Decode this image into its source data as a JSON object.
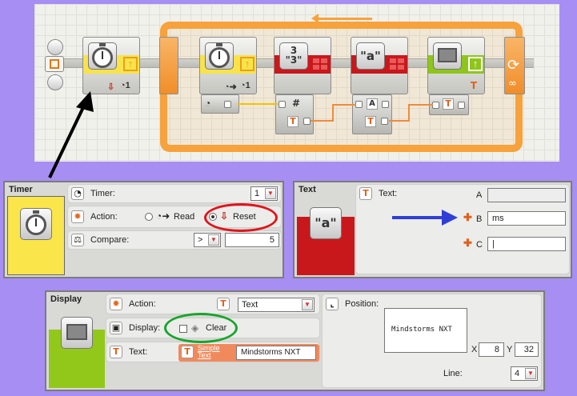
{
  "colors": {
    "background": "#a78ef3",
    "loop": "#f7a23c",
    "timer_accent": "#f8e34a",
    "text_accent": "#c8181c",
    "display_accent": "#8ec51b",
    "wire": "#f08a3b",
    "red_ring": "#e0141b",
    "blue_arrow": "#2f3fd6",
    "green_ring": "#17a52d"
  },
  "program": {
    "icons": [
      "timer-icon",
      "timer-icon",
      "number-to-text-icon",
      "text-icon",
      "display-icon",
      "loop-icon"
    ],
    "glyphs": {
      "num_top": "3",
      "num_bottom": "\"3\"",
      "text_a": "\"a\"",
      "hash": "#",
      "t": "T",
      "a": "A",
      "infinity": "∞"
    }
  },
  "timer_panel": {
    "title": "Timer",
    "timer_label": "Timer:",
    "timer_value": "1",
    "action_label": "Action:",
    "read_label": "Read",
    "reset_label": "Reset",
    "selected_action": "Reset",
    "compare_label": "Compare:",
    "compare_op": ">",
    "compare_value": "5"
  },
  "text_panel": {
    "title": "Text",
    "preview_text": "\"a\"",
    "text_label": "Text:",
    "a_label": "A",
    "a_value": "",
    "b_label": "B",
    "b_value": "ms",
    "c_label": "C",
    "c_value": "|",
    "t_glyph": "T"
  },
  "display_panel": {
    "title": "Display",
    "action_label": "Action:",
    "action_value": "Text",
    "display_label": "Display:",
    "clear_label": "Clear",
    "clear_checked": false,
    "text_label": "Text:",
    "simple_text_link": "Simple Text",
    "text_value": "Mindstorms NXT",
    "position_label": "Position:",
    "preview_text": "Mindstorms NXT",
    "x_label": "X",
    "x_value": "8",
    "y_label": "Y",
    "y_value": "32",
    "line_label": "Line:",
    "line_value": "4",
    "t_glyph": "T"
  }
}
